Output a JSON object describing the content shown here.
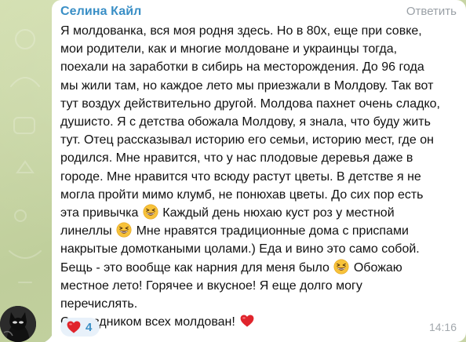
{
  "message": {
    "sender": "Селина Кайл",
    "reply_label": "Ответить",
    "lines": [
      "Я молдованка, вся моя родня здесь. Но в 80х, еще при совке,",
      "мои родители, как и многие молдоване и украинцы тогда,",
      "поехали на заработки в сибирь на месторождения. До 96 года",
      "мы жили там, но каждое лето мы приезжали в Молдову. Так вот",
      "тут воздух действительно другой. Молдова пахнет очень сладко,",
      "душисто. Я с детства обожала Молдову, я знала, что буду жить",
      "тут. Отец рассказывал историю его семьи, историю мест, где он",
      "родился. Мне нравится, что у нас плодовые деревья даже в",
      "городе. Мне нравится что всюду растут цветы. В детстве я не",
      "могла пройти мимо клумб, не понюхав цветы. До сих пор есть",
      "эта привычка",
      "Каждый день нюхаю куст роз у местной",
      "линеллы",
      "Мне нравятся традиционные дома с приспами",
      "накрытые домоткаными цолами.) Еда и вино это само собой.",
      "Бещь - это вообще как нарния для меня было",
      "Обожаю",
      "местное лето! Горячее и вкусное!  Я еще долго могу",
      "перечислять.",
      "С праздником всех молдован!"
    ],
    "emoji_grin": "grinning-squinting-face-icon",
    "emoji_heart": "red-heart-icon",
    "reaction": {
      "emoji": "red-heart-icon",
      "count": "4"
    },
    "time": "14:16"
  },
  "colors": {
    "sender_name": "#3a8fc6",
    "bubble": "#ffffff",
    "chat_background": "#c9d6a8",
    "reaction_bg": "#e8f1fa",
    "heart": "#e0242c"
  }
}
